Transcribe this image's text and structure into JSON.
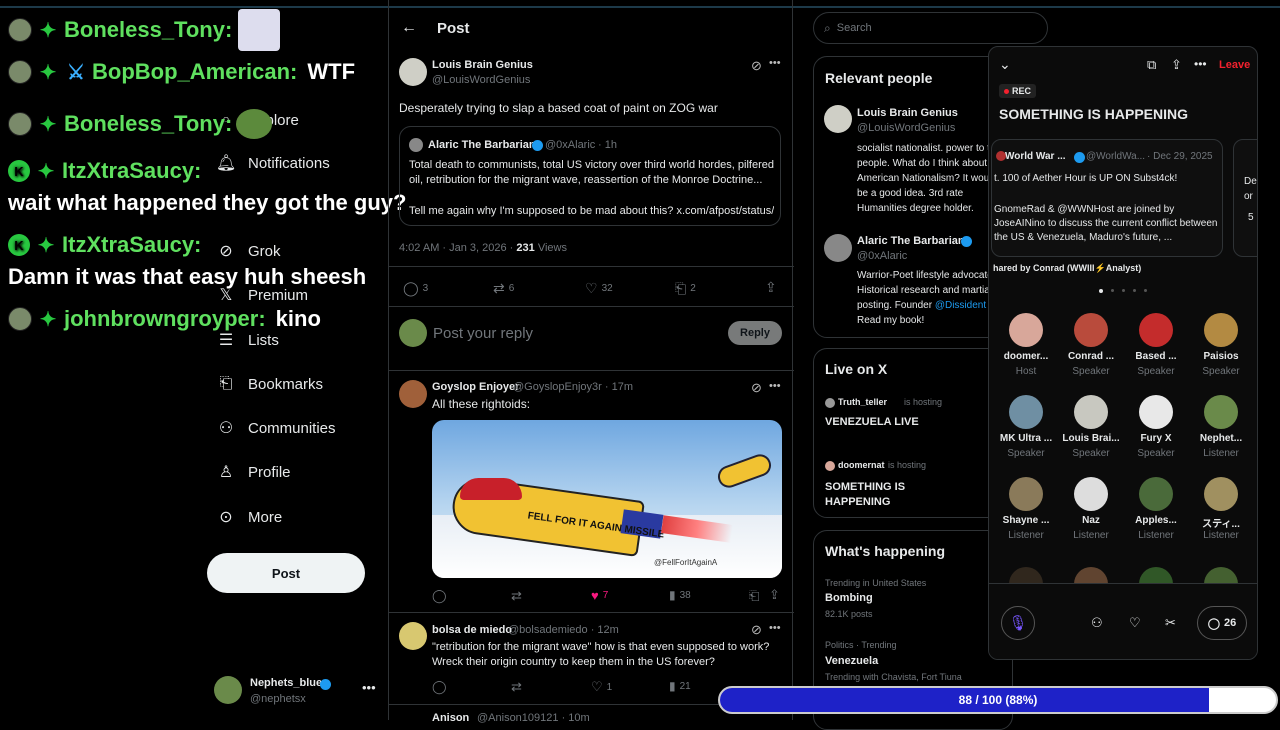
{
  "chat": [
    {
      "name": "Boneless_Tony:",
      "message": ""
    },
    {
      "name": "BopBop_American:",
      "message": "WTF"
    },
    {
      "name": "Boneless_Tony:",
      "message": ""
    },
    {
      "name": "ItzXtraSaucy:",
      "message": "wait what happened they got the guy?"
    },
    {
      "name": "ItzXtraSaucy:",
      "message": "Damn it was that easy huh sheesh"
    },
    {
      "name": "johnbrowngroyper:",
      "message": "kino"
    }
  ],
  "nav": {
    "explore": "Explore",
    "notifications": "Notifications",
    "grok": "Grok",
    "premium": "Premium",
    "lists": "Lists",
    "bookmarks": "Bookmarks",
    "communities": "Communities",
    "profile": "Profile",
    "more": "More",
    "post_button": "Post",
    "account_name": "Nephets_blue",
    "account_handle": "@nephetsx"
  },
  "header": {
    "title": "Post"
  },
  "main_post": {
    "name": "Louis Brain Genius",
    "handle": "@LouisWordGenius",
    "text": "Desperately trying to slap a based coat of paint on ZOG war",
    "quote": {
      "name": "Alaric The Barbarian",
      "handle": "@0xAlaric",
      "time": "· 1h",
      "text1": "Total death to communists, total US victory over third world hordes, pilfered oil, retribution for the migrant wave, reassertion of the Monroe Doctrine...",
      "text2": "Tell me again why I'm supposed to be mad about this? x.com/afpost/status/..."
    },
    "timestamp": "4:02 AM · Jan 3, 2026 · ",
    "views_count": "231",
    "views_label": " Views",
    "replies": "3",
    "reposts": "6",
    "likes": "32",
    "bookmarks": "2"
  },
  "reply_box": {
    "placeholder": "Post your reply",
    "button": "Reply"
  },
  "replies": [
    {
      "name": "Goyslop Enjoyer",
      "handle": "@GoyslopEnjoy3r · 17m",
      "text": "All these rightoids:",
      "image_caption": "FELL FOR IT AGAIN MISSILE",
      "image_watermark": "@FellForItAgainA",
      "reposts": "",
      "likes": "7",
      "views": "38"
    },
    {
      "name": "bolsa de miedo",
      "handle": "@bolsademiedo · 12m",
      "text": "\"retribution for the migrant wave\" how is that even supposed to work? Wreck their origin country to keep them in the US forever?",
      "likes": "1",
      "views": "21"
    },
    {
      "name": "Anison",
      "handle": "@Anison109121 · 10m"
    }
  ],
  "search": {
    "placeholder": "Search"
  },
  "relevant_people": {
    "title": "Relevant people",
    "people": [
      {
        "name": "Louis Brain Genius",
        "handle": "@LouisWordGenius",
        "bio": "socialist nationalist. power to the people. What do I think about American Nationalism? It would be a good idea. 3rd rate Humanities degree holder."
      },
      {
        "name": "Alaric The Barbarian",
        "handle": "@0xAlaric",
        "bio": "Warrior-Poet lifestyle advocate. Historical research and martial posting. Founder ",
        "bio_link": "@Dissident",
        "bio_end": "Read my book!"
      }
    ]
  },
  "live": {
    "title": "Live on X",
    "items": [
      {
        "host": "Truth_teller",
        "hosting": " is hosting",
        "title": "VENEZUELA LIVE"
      },
      {
        "host": "doomernat",
        "hosting": " is hosting",
        "title": "SOMETHING IS HAPPENING"
      }
    ]
  },
  "happening": {
    "title": "What's happening",
    "items": [
      {
        "context": "Trending in United States",
        "topic": "Bombing",
        "posts": "82.1K posts"
      },
      {
        "context": "Politics · Trending",
        "topic": "Venezuela",
        "posts": "Trending with Chavista, Fort Tiuna"
      }
    ]
  },
  "space": {
    "leave": "Leave",
    "rec": "REC",
    "title": "SOMETHING IS HAPPENING",
    "card": {
      "name": "World War ...",
      "handle": "@WorldWa...",
      "date": "· Dec 29, 2025",
      "line1": "t. 100 of Aether Hour is UP ON Subst4ck!",
      "line2": "GnomeRad & @WWNHost are joined by JoseAINino to discuss the current conflict between the US & Venezuela, Maduro's future, ...",
      "shared": "hared by Conrad (WWIII⚡Analyst)"
    },
    "card2_text": "De or",
    "card2_count": "5",
    "participants": [
      {
        "name": "doomer...",
        "role": "Host",
        "color": "#d8a79a"
      },
      {
        "name": "Conrad ...",
        "role": "Speaker",
        "color": "#b94b3c"
      },
      {
        "name": "Based ...",
        "role": "Speaker",
        "color": "#c42c2c"
      },
      {
        "name": "Paisios",
        "role": "Speaker",
        "color": "#b38a42"
      },
      {
        "name": "MK Ultra ...",
        "role": "Speaker",
        "color": "#6f8fa3"
      },
      {
        "name": "Louis Brai...",
        "role": "Speaker",
        "color": "#c8c8c0"
      },
      {
        "name": "Fury X",
        "role": "Speaker",
        "color": "#e8e8e8"
      },
      {
        "name": "Nephet...",
        "role": "Listener",
        "color": "#6a8a4a"
      },
      {
        "name": "Shayne ...",
        "role": "Listener",
        "color": "#8a7a5a"
      },
      {
        "name": "Naz",
        "role": "Listener",
        "color": "#ddd"
      },
      {
        "name": "Apples...",
        "role": "Listener",
        "color": "#4a6a3a"
      },
      {
        "name": "スティ...",
        "role": "Listener",
        "color": "#a09060"
      }
    ],
    "comment_count": "26"
  },
  "progress": {
    "label": "88 / 100 (88%)",
    "fraction": 0.88
  }
}
